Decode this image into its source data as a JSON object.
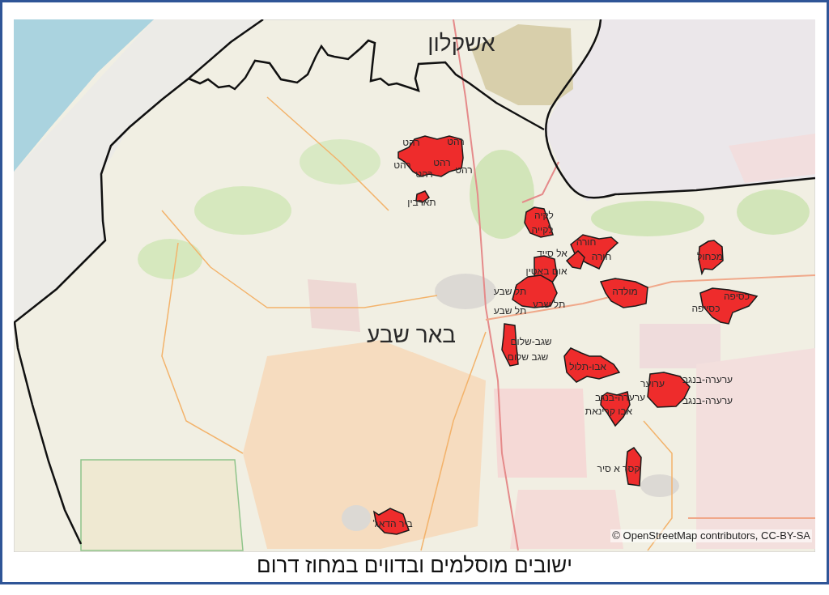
{
  "map": {
    "district_labels": [
      "אשקלון",
      "באר שבע"
    ],
    "settlements": [
      {
        "labels": [
          "רהט",
          "רהט",
          "רהט",
          "רהט",
          "רהט",
          "רהט"
        ]
      },
      {
        "labels": [
          "תארבין"
        ]
      },
      {
        "labels": [
          "לקיה",
          "לקייה"
        ]
      },
      {
        "labels": [
          "מכחול"
        ]
      },
      {
        "labels": [
          "חורה",
          "חורה"
        ]
      },
      {
        "labels": [
          "אל סייד"
        ]
      },
      {
        "labels": [
          "אום באטין"
        ]
      },
      {
        "labels": [
          "כסיפה",
          "כסייפה"
        ]
      },
      {
        "labels": [
          "מולדה"
        ]
      },
      {
        "labels": [
          "תל שבע",
          "תל שבע",
          "תל שבע"
        ]
      },
      {
        "labels": [
          "אבו-תלול"
        ]
      },
      {
        "labels": [
          "שגב-שלום",
          "שגב שלום"
        ]
      },
      {
        "labels": [
          "ערוער",
          "ערערה-בנגב",
          "ערערה-בנגב"
        ]
      },
      {
        "labels": [
          "ערערה-בנגב",
          "אבו קרינאת"
        ]
      },
      {
        "labels": [
          "קסר א סיר"
        ]
      },
      {
        "labels": [
          "ביר הדאג'"
        ]
      }
    ],
    "attribution": "© OpenStreetMap contributors, CC-BY-SA"
  },
  "caption": "ישובים מוסלמים ובדווים במחוז דרום"
}
